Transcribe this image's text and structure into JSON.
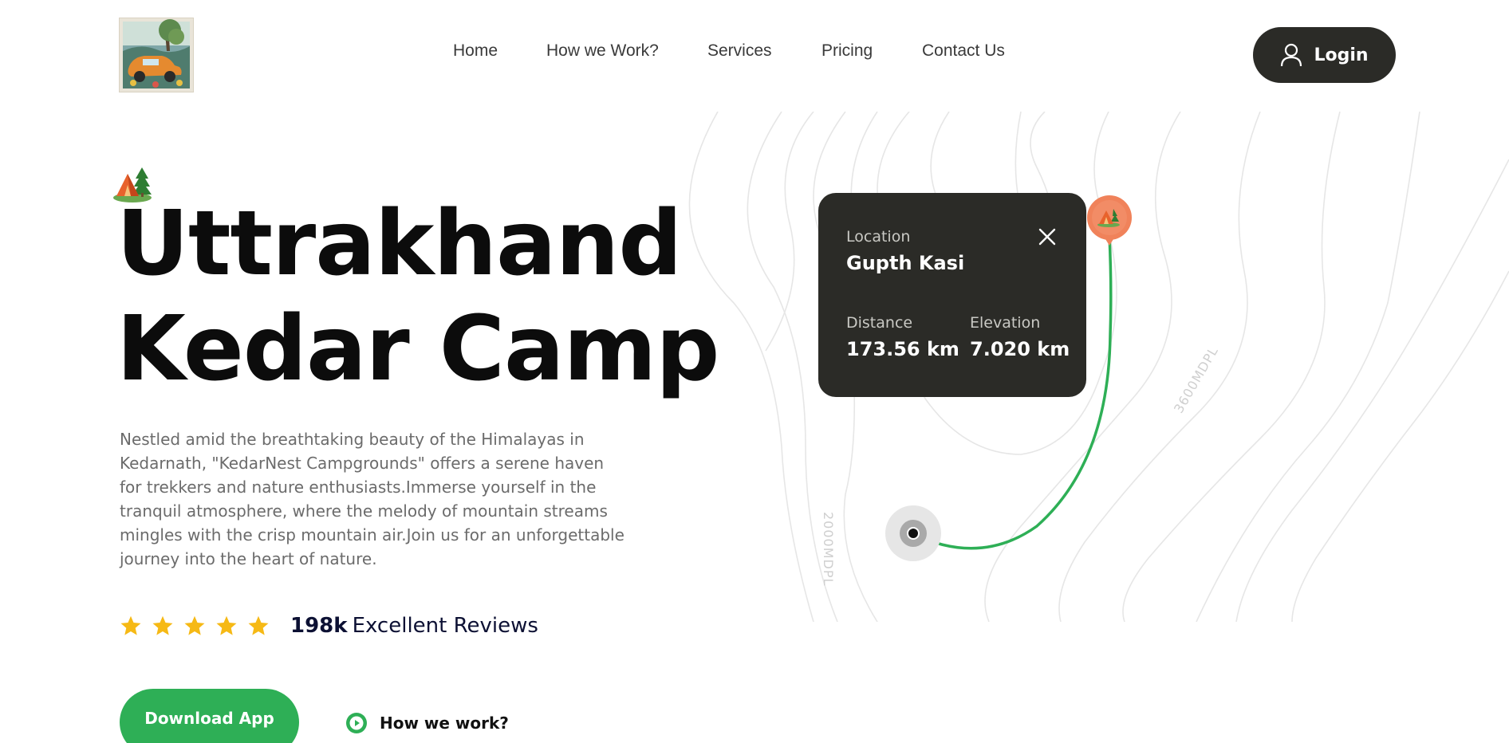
{
  "nav": {
    "items": [
      {
        "label": "Home"
      },
      {
        "label": "How we Work?"
      },
      {
        "label": "Services"
      },
      {
        "label": "Pricing"
      },
      {
        "label": "Contact Us"
      }
    ],
    "login_label": "Login"
  },
  "hero": {
    "title_line1": "Uttrakhand",
    "title_line2": "Kedar Camp",
    "description": "Nestled amid the breathtaking beauty of the Himalayas in Kedarnath, \"KedarNest Campgrounds\" offers a serene haven for trekkers and nature enthusiasts.Immerse yourself in the tranquil atmosphere, where the melody of mountain streams mingles with the crisp mountain air.Join us for an unforgettable journey into the heart of nature.",
    "rating": {
      "stars": 5,
      "count": "198k",
      "label": "Excellent Reviews"
    },
    "download_label": "Download App",
    "how_label": "How we work?"
  },
  "map": {
    "contour_label_left": "2000MDPL",
    "contour_label_right": "3600MDPL",
    "card": {
      "location_label": "Location",
      "location_value": "Gupth Kasi",
      "distance_label": "Distance",
      "distance_value": "173.56 km",
      "elevation_label": "Elevation",
      "elevation_value": "7.020 km"
    }
  },
  "colors": {
    "accent_green": "#2eaf56",
    "dark": "#2b2b27",
    "star_yellow": "#f6b915",
    "pin_orange": "#f0825a"
  }
}
